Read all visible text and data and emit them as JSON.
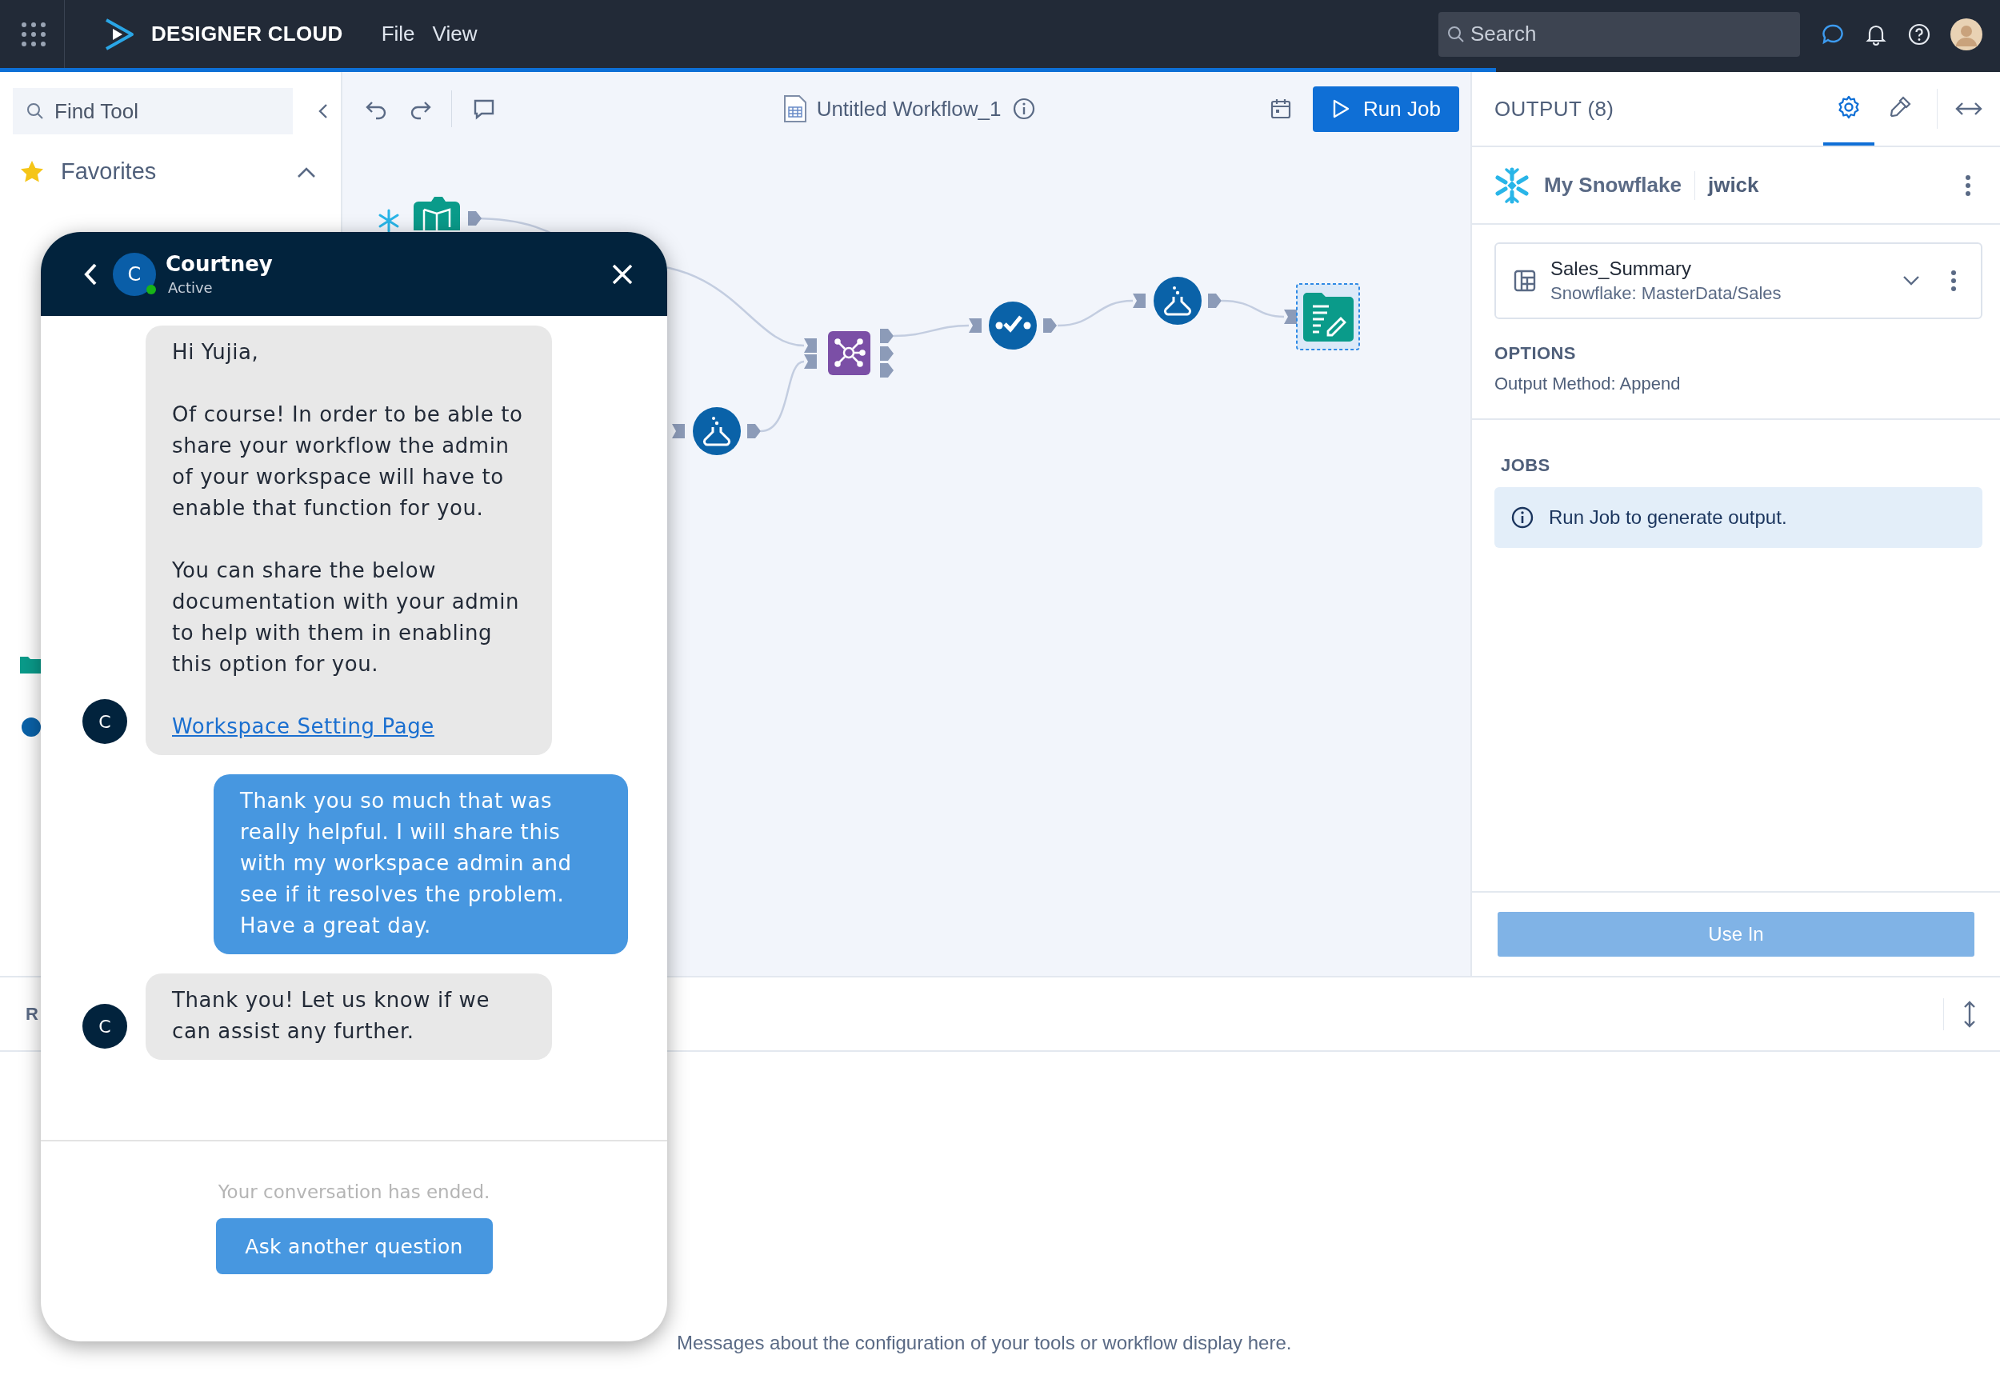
{
  "top_bar": {
    "app_name": "DESIGNER CLOUD",
    "menu": [
      "File",
      "View"
    ],
    "search": {
      "placeholder": "Search"
    }
  },
  "loading_bar": {
    "level": 0.748
  },
  "sidebar": {
    "search": {
      "placeholder": "Find Tool"
    },
    "sections": [
      {
        "label": "Favorites",
        "expanded": true
      }
    ]
  },
  "canvas_toolbar": {
    "workflow_name": "Untitled Workflow_1",
    "run_button": "Run Job"
  },
  "canvas": {
    "nodes": [
      {
        "kind": "source",
        "selected": false
      },
      {
        "kind": "flask",
        "selected": false
      },
      {
        "kind": "join",
        "selected": false
      },
      {
        "kind": "check",
        "selected": false
      },
      {
        "kind": "flask",
        "selected": false
      },
      {
        "kind": "output",
        "selected": true
      }
    ]
  },
  "output_panel": {
    "title": "OUTPUT (8)",
    "tabs": [
      {
        "kind": "settings",
        "selected": true
      },
      {
        "kind": "picker",
        "selected": false
      }
    ],
    "connection": {
      "name": "My Snowflake",
      "user": "jwick"
    },
    "table": {
      "name": "Sales_Summary",
      "path": "Snowflake: MasterData/Sales"
    },
    "options": {
      "heading": "OPTIONS",
      "text": "Output Method: Append"
    },
    "jobs": {
      "heading": "JOBS",
      "message": "Run Job to generate output."
    },
    "button": {
      "label": "Use In",
      "disabled": true
    }
  },
  "bottom_panel": {
    "tab": "R",
    "message": "Messages about the configuration of your tools or workflow display here."
  },
  "chat": {
    "agent": {
      "name": "Courtney",
      "initial": "C",
      "status": "Active",
      "online": true
    },
    "messages": [
      {
        "kind": "agent",
        "avatar": "C",
        "paragraphs": [
          "Hi Yujia,",
          "Of course! In order to be able to share your workflow the admin of your workspace will have to enable that function for you.",
          "You can share the below documentation with your admin to help with them in enabling this option for you."
        ],
        "link": "Workspace Setting Page"
      },
      {
        "kind": "user",
        "paragraphs": [
          "Thank you so much that was really helpful. I will share this with my workspace admin and see if it resolves the problem. Have a great day."
        ]
      },
      {
        "kind": "agent",
        "avatar": "C",
        "paragraphs": [
          "Thank you! Let us know if we can assist any further."
        ]
      }
    ],
    "ended_text": "Your conversation has ended.",
    "button": "Ask another question"
  }
}
